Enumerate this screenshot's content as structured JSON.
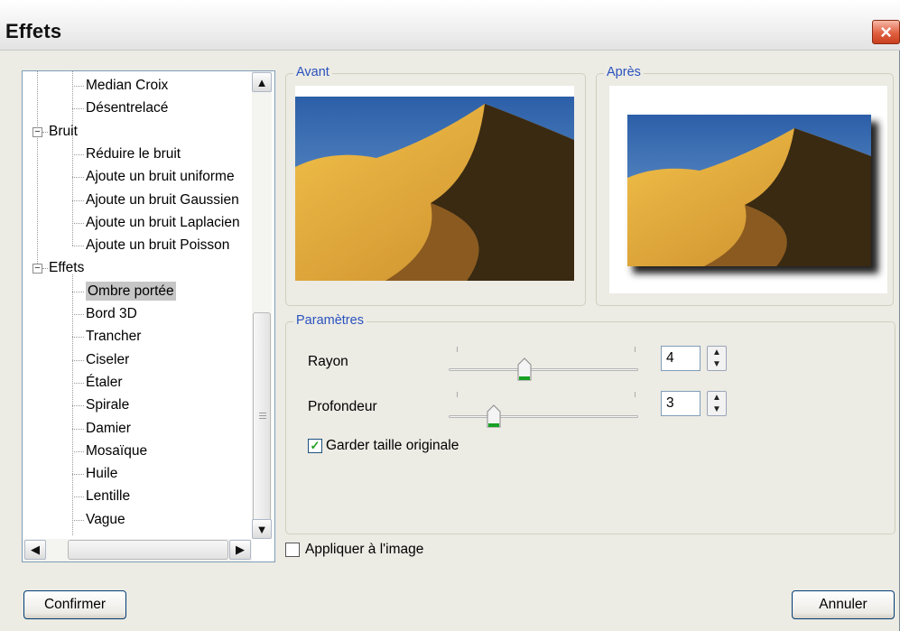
{
  "window": {
    "title": "Effets",
    "close_glyph": "×"
  },
  "tree": {
    "items": [
      {
        "label": "Median Croix",
        "level": 2
      },
      {
        "label": "Désentrelacé",
        "level": 2
      },
      {
        "label": "Bruit",
        "level": 1,
        "expander": "−"
      },
      {
        "label": "Réduire le bruit",
        "level": 2
      },
      {
        "label": "Ajoute un bruit uniforme",
        "level": 2
      },
      {
        "label": "Ajoute un bruit Gaussien",
        "level": 2
      },
      {
        "label": "Ajoute un bruit Laplacien",
        "level": 2
      },
      {
        "label": "Ajoute un bruit Poisson",
        "level": 2
      },
      {
        "label": "Effets",
        "level": 1,
        "expander": "−"
      },
      {
        "label": "Ombre portée",
        "level": 2,
        "selected": true
      },
      {
        "label": "Bord 3D",
        "level": 2
      },
      {
        "label": "Trancher",
        "level": 2
      },
      {
        "label": "Ciseler",
        "level": 2
      },
      {
        "label": "Étaler",
        "level": 2
      },
      {
        "label": "Spirale",
        "level": 2
      },
      {
        "label": "Damier",
        "level": 2
      },
      {
        "label": "Mosaïque",
        "level": 2
      },
      {
        "label": "Huile",
        "level": 2
      },
      {
        "label": "Lentille",
        "level": 2
      },
      {
        "label": "Vague",
        "level": 2
      }
    ],
    "scroll_up_icon": "▲",
    "scroll_down_icon": "▼",
    "scroll_left_icon": "◀",
    "scroll_right_icon": "▶"
  },
  "preview": {
    "before_label": "Avant",
    "after_label": "Après"
  },
  "params": {
    "legend": "Paramètres",
    "rayon": {
      "label": "Rayon",
      "value": "4",
      "position": 0.4
    },
    "profondeur": {
      "label": "Profondeur",
      "value": "3",
      "position": 0.24
    },
    "keep_size": {
      "label": "Garder taille originale",
      "checked": true,
      "glyph": "✓"
    }
  },
  "apply": {
    "label": "Appliquer à l'image",
    "checked": false
  },
  "buttons": {
    "confirm": "Confirmer",
    "cancel": "Annuler"
  },
  "colors": {
    "accent": "#2a52be",
    "selection": "#c6c6c6",
    "slider_thumb": "#18a025"
  }
}
